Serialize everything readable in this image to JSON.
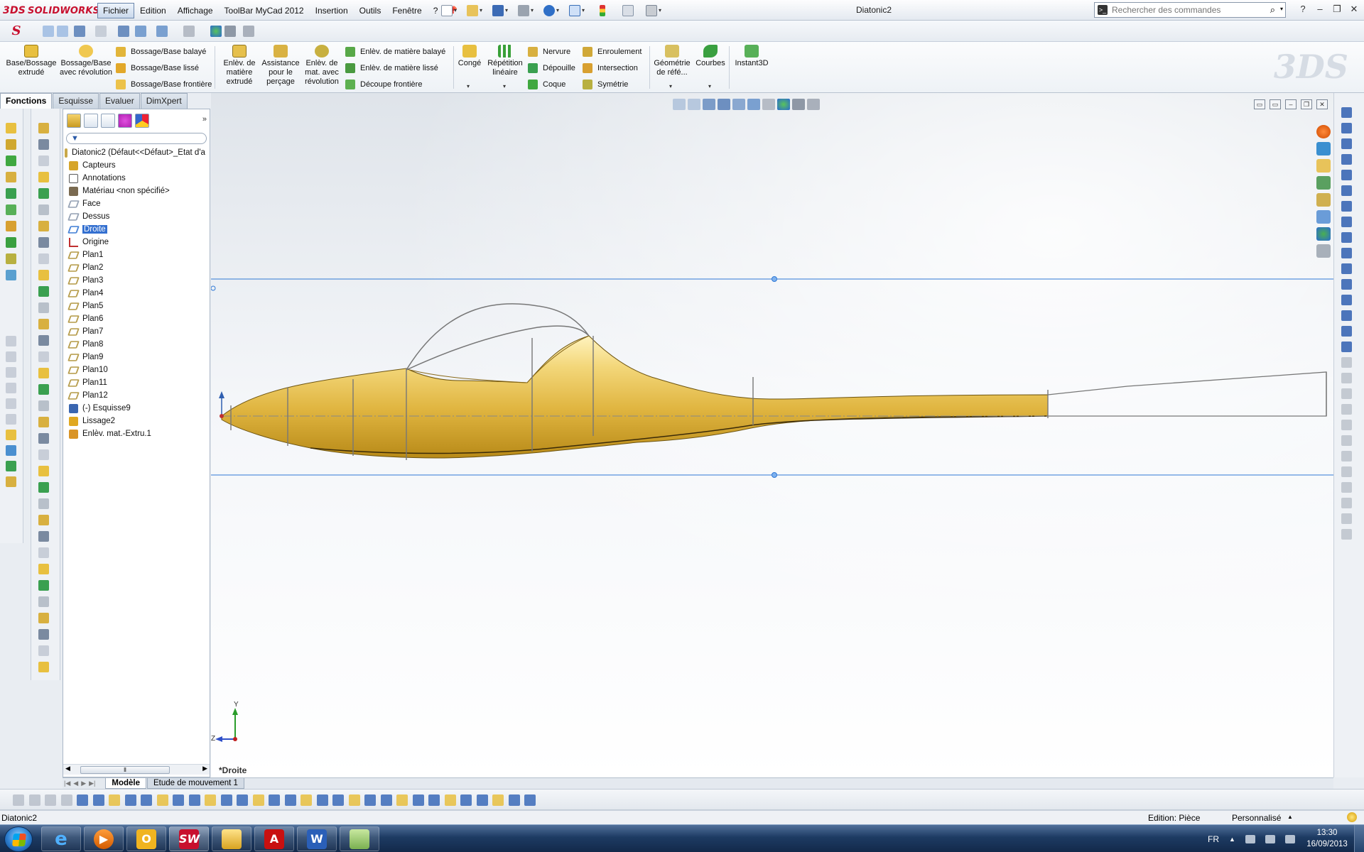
{
  "app": {
    "logo_text": "SOLIDWORKS",
    "logo_ds": "3DS",
    "document_title": "Diatonic2",
    "menu": [
      "Fichier",
      "Edition",
      "Affichage",
      "ToolBar MyCad 2012",
      "Insertion",
      "Outils",
      "Fenêtre",
      "?"
    ],
    "search_placeholder": "Rechercher des commandes",
    "help_label": "?",
    "window_controls": [
      "–",
      "❐",
      "✕"
    ]
  },
  "command_manager": {
    "bossage_base_extrude": "Base/Bossage extrudé",
    "bossage_base_revolution": "Bossage/Base avec révolution",
    "bossage_balaye": "Bossage/Base balayé",
    "bossage_lisse": "Bossage/Base lissé",
    "bossage_frontiere": "Bossage/Base frontière",
    "enlev_matiere_extrude": "Enlèv. de matière extrudé",
    "assistance_percage": "Assistance pour le perçage",
    "enlev_revolution": "Enlèv. de mat. avec révolution",
    "enlev_balaye": "Enlèv. de matière balayé",
    "enlev_lisse": "Enlèv. de matière lissé",
    "decoupe_frontiere": "Découpe frontière",
    "conge": "Congé",
    "repetition_lineaire": "Répétition linéaire",
    "nervure": "Nervure",
    "depouille": "Dépouille",
    "coque": "Coque",
    "enroulement": "Enroulement",
    "intersection": "Intersection",
    "symetrie": "Symétrie",
    "geometrie_ref": "Géométrie de réfé...",
    "courbes": "Courbes",
    "instant3d": "Instant3D"
  },
  "tabs": [
    "Fonctions",
    "Esquisse",
    "Evaluer",
    "DimXpert"
  ],
  "feature_tree": {
    "root": "Diatonic2  (Défaut<<Défaut>_Etat d'a",
    "items": [
      {
        "label": "Capteurs",
        "icon": "sensor-folder-icon",
        "color": "#d6a52a"
      },
      {
        "label": "Annotations",
        "icon": "annotation-icon",
        "color": "#5a5a5a"
      },
      {
        "label": "Matériau <non spécifié>",
        "icon": "material-icon",
        "color": "#7a6a50"
      },
      {
        "label": "Face",
        "icon": "plane-icon",
        "color": "#9aa6b8"
      },
      {
        "label": "Dessus",
        "icon": "plane-icon",
        "color": "#9aa6b8"
      },
      {
        "label": "Droite",
        "icon": "plane-icon",
        "color": "#4c86d8",
        "selected": true
      },
      {
        "label": "Origine",
        "icon": "origin-icon",
        "color": "#c03030"
      },
      {
        "label": "Plan1",
        "icon": "plane-icon",
        "color": "#b9a052"
      },
      {
        "label": "Plan2",
        "icon": "plane-icon",
        "color": "#b9a052"
      },
      {
        "label": "Plan3",
        "icon": "plane-icon",
        "color": "#b9a052"
      },
      {
        "label": "Plan4",
        "icon": "plane-icon",
        "color": "#b9a052"
      },
      {
        "label": "Plan5",
        "icon": "plane-icon",
        "color": "#b9a052"
      },
      {
        "label": "Plan6",
        "icon": "plane-icon",
        "color": "#b9a052"
      },
      {
        "label": "Plan7",
        "icon": "plane-icon",
        "color": "#b9a052"
      },
      {
        "label": "Plan8",
        "icon": "plane-icon",
        "color": "#b9a052"
      },
      {
        "label": "Plan9",
        "icon": "plane-icon",
        "color": "#b9a052"
      },
      {
        "label": "Plan10",
        "icon": "plane-icon",
        "color": "#b9a052"
      },
      {
        "label": "Plan11",
        "icon": "plane-icon",
        "color": "#b9a052"
      },
      {
        "label": "Plan12",
        "icon": "plane-icon",
        "color": "#b9a052"
      },
      {
        "label": "(-) Esquisse9",
        "icon": "sketch-icon",
        "color": "#3a66b0"
      },
      {
        "label": "Lissage2",
        "icon": "loft-icon",
        "color": "#e0a820"
      },
      {
        "label": "Enlèv. mat.-Extru.1",
        "icon": "cut-extrude-icon",
        "color": "#d99426"
      }
    ]
  },
  "graphics": {
    "view_name": "*Droite",
    "triad_y": "Y",
    "triad_z": "Z",
    "model_color": "#e6b94a"
  },
  "bottom_tabs": [
    "Modèle",
    "Etude de mouvement 1"
  ],
  "status": {
    "document": "Diatonic2",
    "edit_mode": "Edition: Pièce",
    "units": "Personnalisé"
  },
  "taskbar": {
    "language": "FR",
    "time": "13:30",
    "date": "16/09/2013",
    "apps": [
      "Internet Explorer",
      "Media Player",
      "Outlook",
      "SolidWorks",
      "Explorer",
      "Acrobat",
      "Word",
      "Image"
    ]
  }
}
